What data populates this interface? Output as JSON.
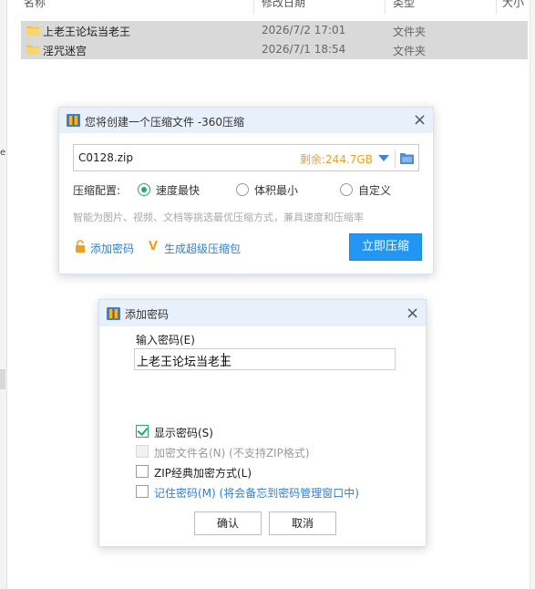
{
  "explorer": {
    "columns": {
      "name": "名称",
      "modified": "修改日期",
      "type": "类型",
      "size": "大小"
    },
    "rows": [
      {
        "name": "上老王论坛当老王",
        "modified": "2026/7/2 17:01",
        "type": "文件夹"
      },
      {
        "name": "淫咒迷宫",
        "modified": "2026/7/1 18:54",
        "type": "文件夹"
      }
    ],
    "left_glyph": "e"
  },
  "compress_dialog": {
    "title": "您将创建一个压缩文件 -360压缩",
    "file_name": "C0128.zip",
    "free_space": "剩余:244.7GB",
    "config_label": "压缩配置:",
    "options": [
      {
        "label": "速度最快",
        "selected": true
      },
      {
        "label": "体积最小",
        "selected": false
      },
      {
        "label": "自定义",
        "selected": false
      }
    ],
    "hint": "智能为图片、视频、文档等挑选最优压缩方式，兼具速度和压缩率",
    "add_password": "添加密码",
    "super_package": "生成超级压缩包",
    "compress_now": "立即压缩"
  },
  "password_dialog": {
    "title": "添加密码",
    "input_label": "输入密码(E)",
    "password_value": "上老王论坛当老王",
    "checkboxes": [
      {
        "label": "显示密码(S)",
        "checked": true,
        "disabled": false
      },
      {
        "label": "加密文件名(N) (不支持ZIP格式)",
        "checked": false,
        "disabled": true
      },
      {
        "label": "ZIP经典加密方式(L)",
        "checked": false,
        "disabled": false
      },
      {
        "label": "记住密码(M) (将会备忘到密码管理窗口中)",
        "checked": false,
        "disabled": false
      }
    ],
    "ok": "确认",
    "cancel": "取消"
  },
  "colors": {
    "accent_blue": "#2196f3",
    "radio_green": "#2aa672",
    "free_space_orange": "#f0a020",
    "title_bar": "#e8f1fb",
    "folder_yellow": "#f5c542"
  },
  "icons": {
    "folder": "folder-icon",
    "app": "360-zip-icon",
    "close": "close-icon",
    "dropdown": "chevron-down-icon",
    "browse": "folder-browse-icon",
    "lock": "lock-icon",
    "super": "v-badge-icon"
  }
}
